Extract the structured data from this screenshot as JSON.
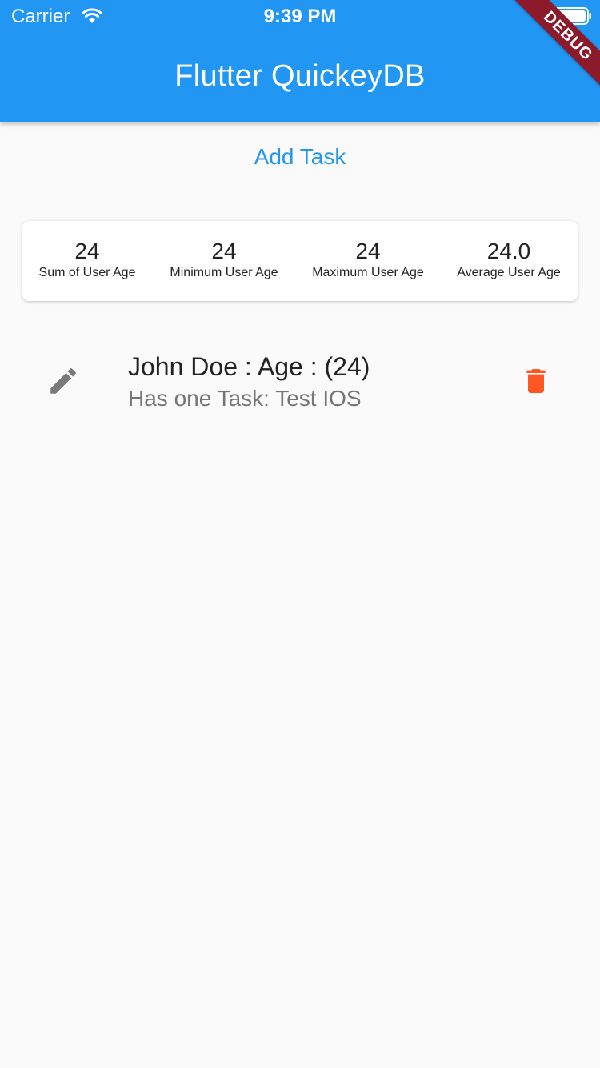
{
  "status_bar": {
    "carrier": "Carrier",
    "time": "9:39 PM",
    "wifi_icon": "wifi-icon",
    "battery_icon": "battery-icon"
  },
  "app_bar": {
    "title": "Flutter QuickeyDB",
    "background_color": "#2196f3",
    "debug_banner": "DEBUG"
  },
  "actions": {
    "add_task_label": "Add Task"
  },
  "stats": [
    {
      "value": "24",
      "label": "Sum of User Age"
    },
    {
      "value": "24",
      "label": "Minimum User Age"
    },
    {
      "value": "24",
      "label": "Maximum User Age"
    },
    {
      "value": "24.0",
      "label": "Average User Age"
    }
  ],
  "users": [
    {
      "title": "John Doe : Age : (24)",
      "subtitle": "Has one Task: Test IOS",
      "leading_icon": "pencil-icon",
      "trailing_icon": "trash-icon",
      "trailing_icon_color": "#ff5722"
    }
  ]
}
